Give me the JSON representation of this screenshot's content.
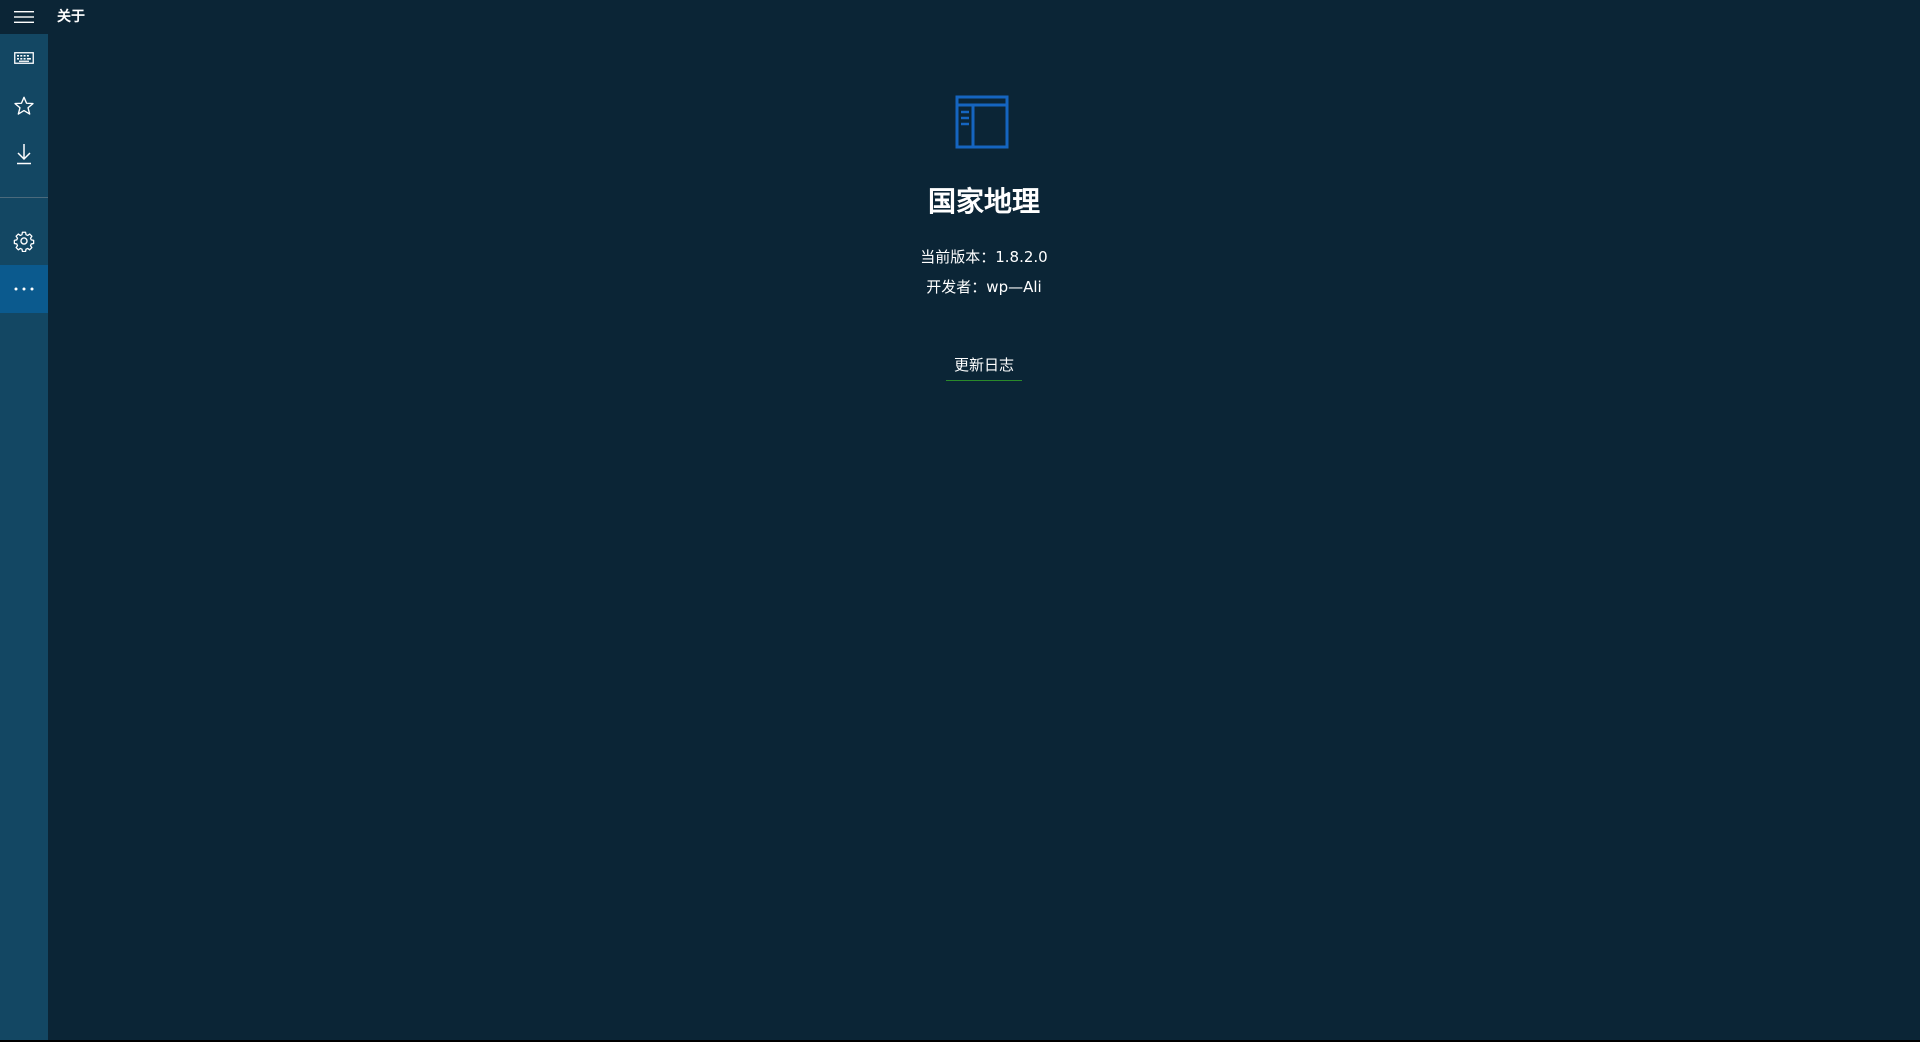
{
  "titlebar": {
    "menu_icon": "hamburger-menu-icon",
    "title": "关于"
  },
  "sidebar": {
    "items": [
      {
        "id": "keyboard",
        "icon": "keyboard-icon",
        "selected": false
      },
      {
        "id": "favorites",
        "icon": "star-icon",
        "selected": false
      },
      {
        "id": "downloads",
        "icon": "download-icon",
        "selected": false
      },
      {
        "id": "settings",
        "icon": "gear-icon",
        "selected": false
      },
      {
        "id": "more",
        "icon": "more-icon",
        "selected": true
      }
    ]
  },
  "about": {
    "app_icon": "app-window-icon",
    "app_name": "国家地理",
    "version_text": "当前版本：1.8.2.0",
    "developer_text": "开发者：wp—Ali",
    "changelog_label": "更新日志"
  },
  "colors": {
    "background": "#0b2536",
    "sidebar": "#134763",
    "selected": "#0b5a8e",
    "accent": "#1565c0",
    "link_underline": "#2a8a2a",
    "text": "#ffffff"
  }
}
